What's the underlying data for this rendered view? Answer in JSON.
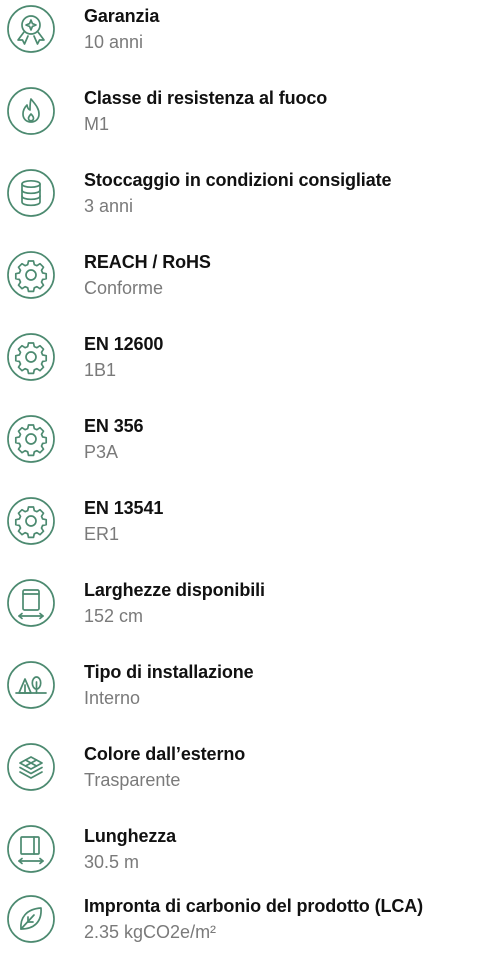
{
  "colors": {
    "accent": "#4c8a70",
    "title": "#111111",
    "value": "#7a7a7a"
  },
  "specs": [
    {
      "icon": "award-icon",
      "title": "Garanzia",
      "value": "10 anni"
    },
    {
      "icon": "fire-icon",
      "title": "Classe di resistenza al fuoco",
      "value": "M1"
    },
    {
      "icon": "storage-icon",
      "title": "Stoccaggio in condizioni consigliate",
      "value": "3 anni"
    },
    {
      "icon": "gear-icon",
      "title": "REACH / RoHS",
      "value": "Conforme"
    },
    {
      "icon": "gear-icon",
      "title": "EN 12600",
      "value": "1B1"
    },
    {
      "icon": "gear-icon",
      "title": "EN 356",
      "value": "P3A"
    },
    {
      "icon": "gear-icon",
      "title": "EN 13541",
      "value": "ER1"
    },
    {
      "icon": "roll-width-icon",
      "title": "Larghezze disponibili",
      "value": "152 cm"
    },
    {
      "icon": "indoor-outdoor-icon",
      "title": "Tipo di installazione",
      "value": "Interno"
    },
    {
      "icon": "layers-icon",
      "title": "Colore dall’esterno",
      "value": "Trasparente"
    },
    {
      "icon": "length-icon",
      "title": "Lunghezza",
      "value": "30.5 m"
    },
    {
      "icon": "leaf-icon",
      "title": "Impronta di carbonio del prodotto (LCA)",
      "value": "2.35 kgCO2e/m²"
    }
  ]
}
